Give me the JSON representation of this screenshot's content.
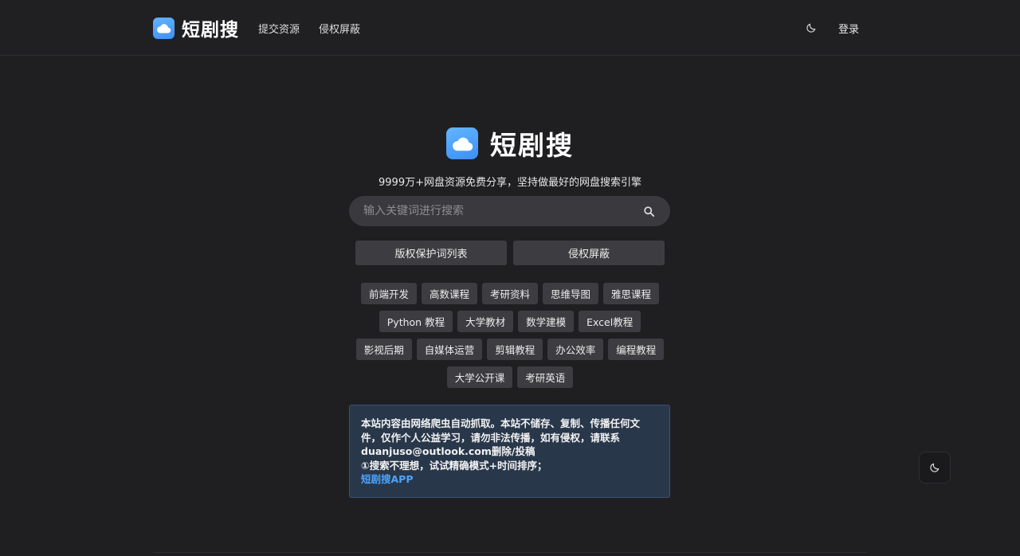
{
  "header": {
    "brand": "短剧搜",
    "nav": [
      "提交资源",
      "侵权屏蔽"
    ],
    "login": "登录"
  },
  "hero": {
    "title": "短剧搜",
    "tagline": "9999万+网盘资源免费分享，坚持做最好的网盘搜索引擎"
  },
  "search": {
    "placeholder": "输入关键词进行搜索",
    "value": ""
  },
  "buttons": [
    "版权保护词列表",
    "侵权屏蔽"
  ],
  "tags": [
    [
      "前端开发",
      "高数课程",
      "考研资料",
      "思维导图",
      "雅思课程"
    ],
    [
      "Python 教程",
      "大学教材",
      "数学建模",
      "Excel教程"
    ],
    [
      "影视后期",
      "自媒体运营",
      "剪辑教程",
      "办公效率",
      "编程教程"
    ],
    [
      "大学公开课",
      "考研英语"
    ]
  ],
  "notice": {
    "line1": "本站内容由网络爬虫自动抓取。本站不储存、复制、传播任何文件，仅作个人公益学习，请勿非法传播，如有侵权，请联系duanjuso@outlook.com删除/投稿",
    "line2": "①搜索不理想，试试精确模式+时间排序；",
    "link": "短剧搜APP"
  },
  "icons": {
    "logo": "cloud-icon",
    "theme": "moon-icon",
    "search": "search-icon"
  },
  "colors": {
    "background": "#1f1f22",
    "accent": "#4da3ff",
    "logo": "#4a9ef7"
  }
}
